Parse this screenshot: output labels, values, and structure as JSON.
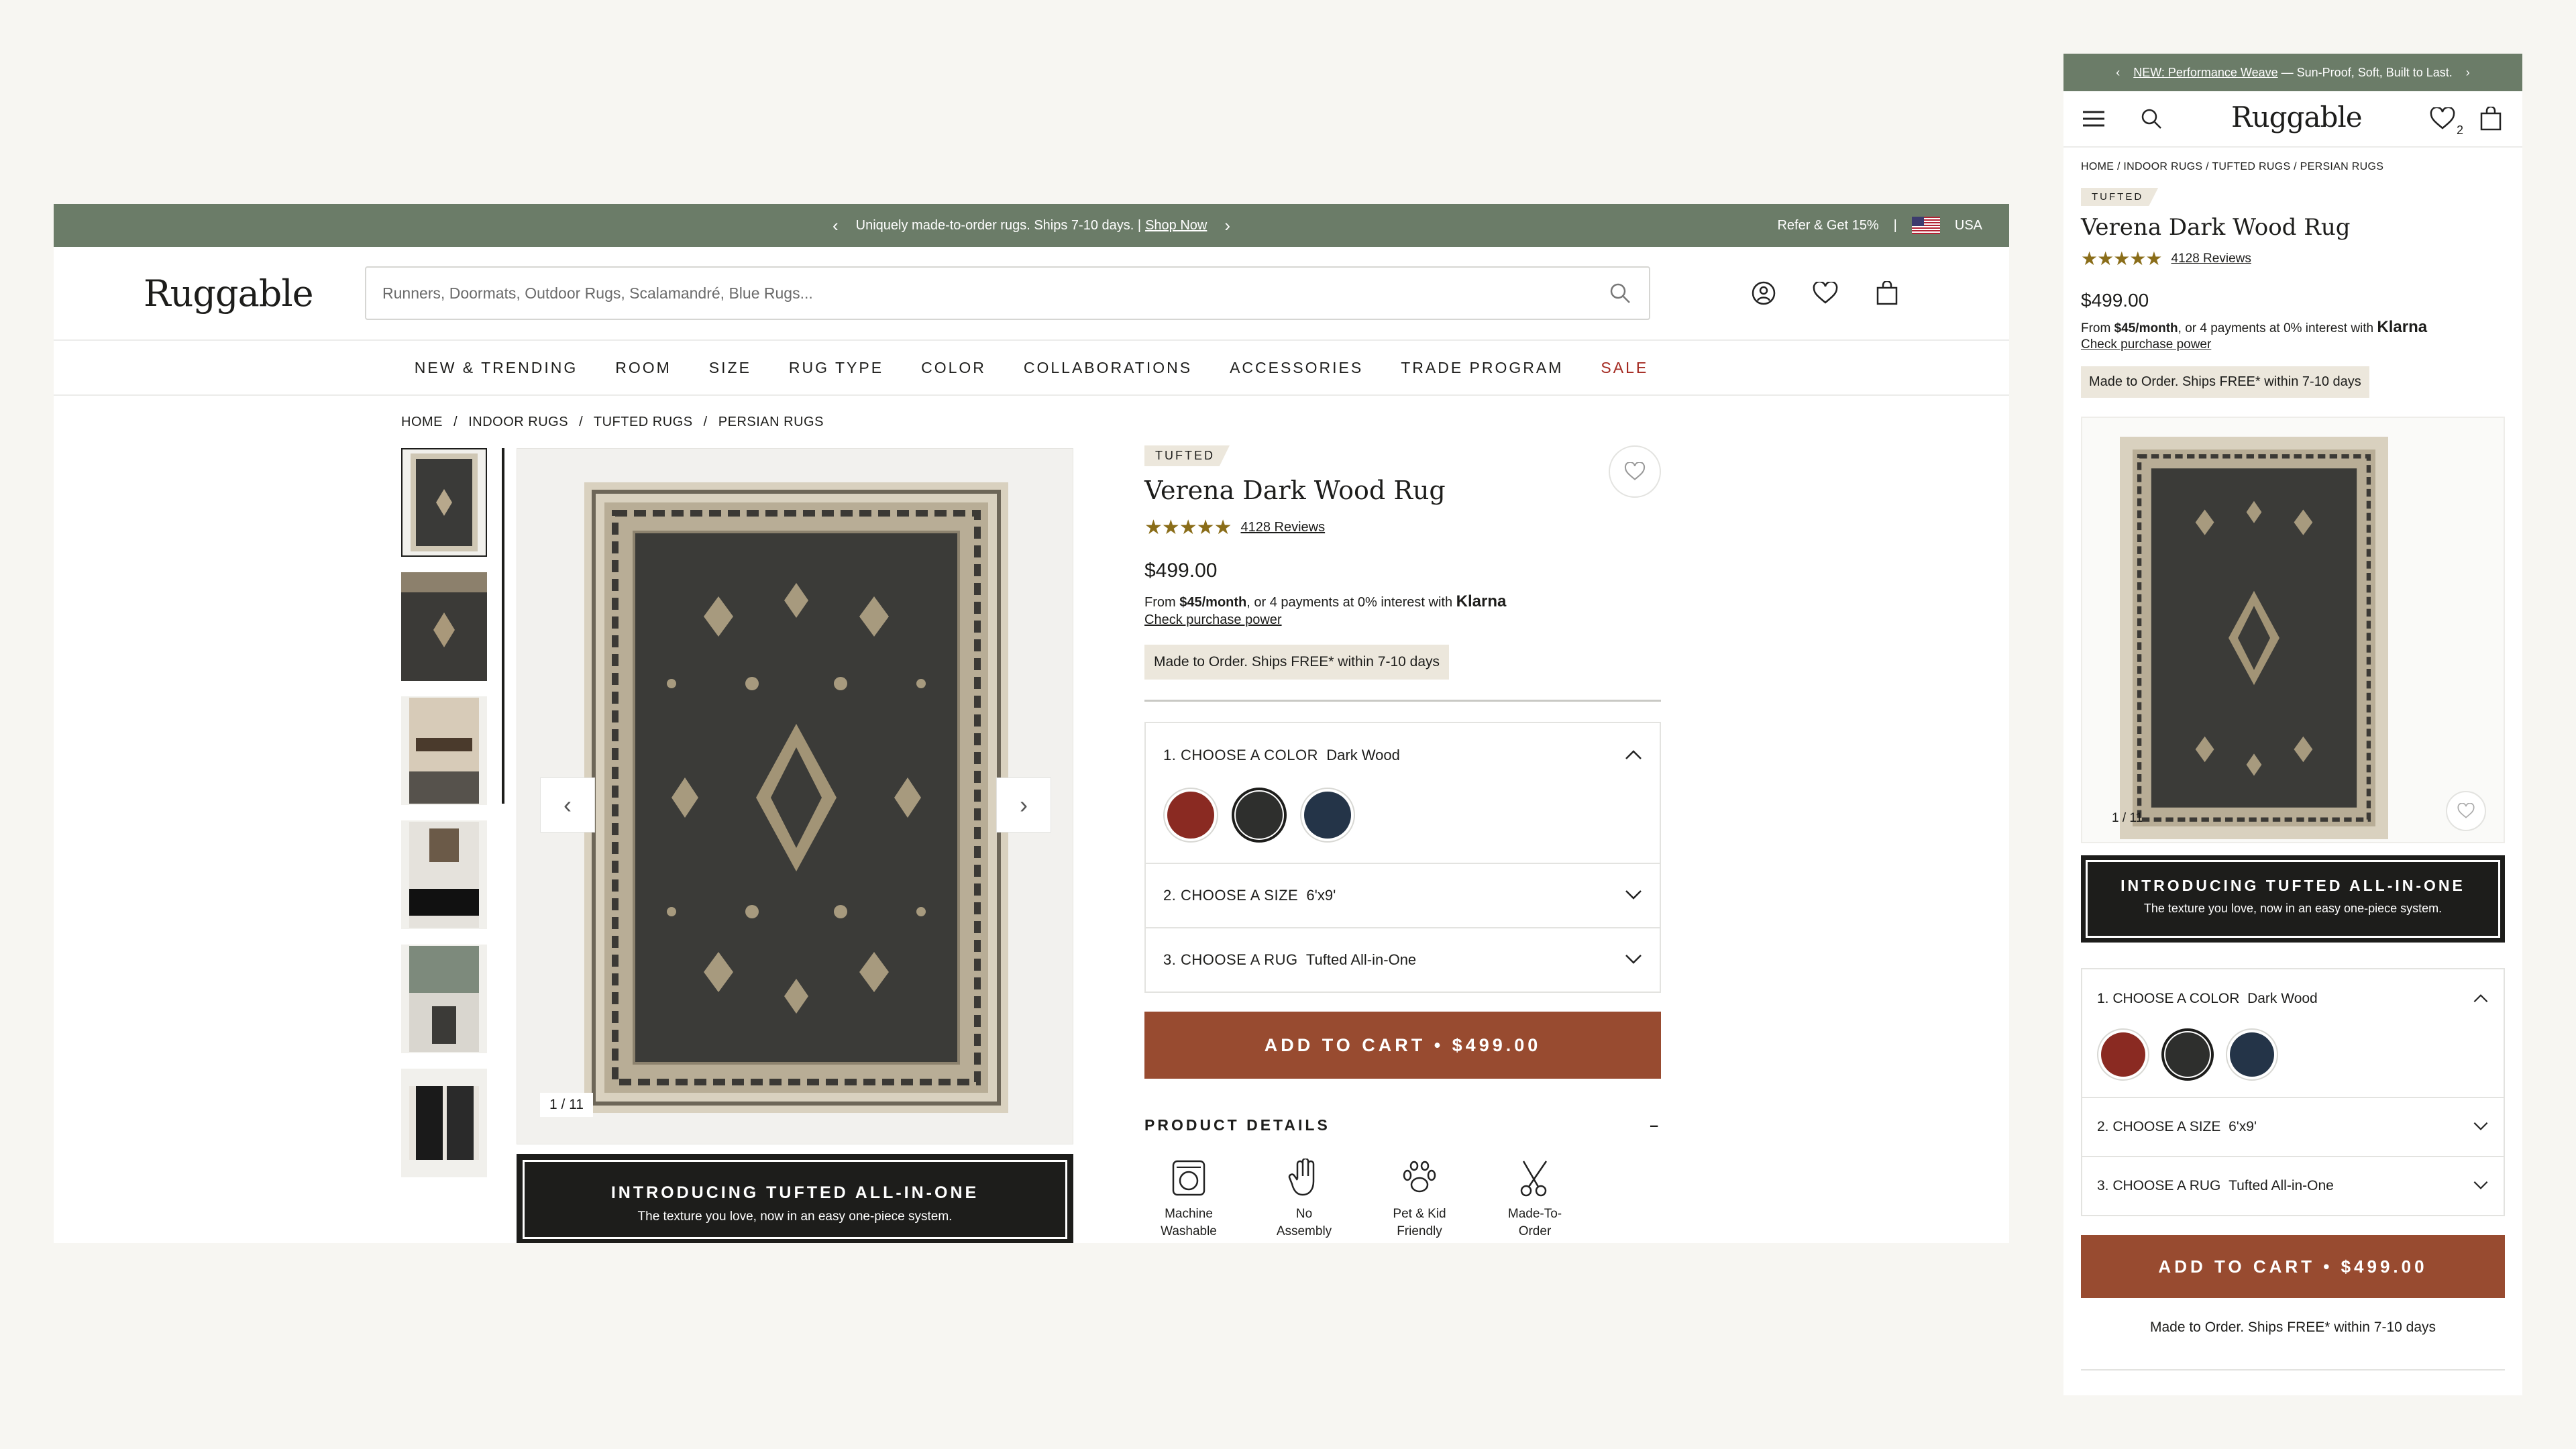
{
  "desktop": {
    "promo": {
      "message": "Uniquely made-to-order rugs. Ships 7-10 days. |",
      "link": "Shop Now",
      "refer": "Refer & Get 15%",
      "separator": "|",
      "country": "USA"
    },
    "logo": "Ruggable",
    "search_placeholder": "Runners, Doormats, Outdoor Rugs, Scalamandré, Blue Rugs...",
    "nav": [
      "NEW & TRENDING",
      "ROOM",
      "SIZE",
      "RUG TYPE",
      "COLOR",
      "COLLABORATIONS",
      "ACCESSORIES",
      "TRADE PROGRAM",
      "SALE"
    ],
    "breadcrumb": [
      "HOME",
      "/",
      "INDOOR RUGS",
      "/",
      "TUFTED RUGS",
      "/",
      "PERSIAN RUGS"
    ],
    "gallery": {
      "counter": "1 / 11"
    },
    "intro": {
      "title": "INTRODUCING TUFTED ALL-IN-ONE",
      "subtitle": "The texture you love, now in an easy one-piece system."
    },
    "product": {
      "badge": "TUFTED",
      "title": "Verena Dark Wood Rug",
      "rating": 5,
      "reviews": "4128 Reviews",
      "price": "$499.00",
      "klarna_from": "From",
      "klarna_amount": "$45/month",
      "klarna_rest": ", or 4 payments at 0% interest with",
      "klarna_brand": "Klarna",
      "klarna_link": "Check purchase power",
      "ship_note": "Made to Order. Ships FREE* within 7-10 days"
    },
    "options": [
      {
        "label": "1. CHOOSE A COLOR",
        "value": "Dark Wood"
      },
      {
        "label": "2. CHOOSE A SIZE",
        "value": "6'x9'"
      },
      {
        "label": "3. CHOOSE A RUG",
        "value": "Tufted All-in-One"
      }
    ],
    "swatch_colors": [
      "#8a2a22",
      "#2e2f2d",
      "#243448"
    ],
    "cart_label": "ADD TO CART • $499.00",
    "details_title": "PRODUCT DETAILS",
    "details_toggle": "–",
    "features": [
      {
        "line1": "Machine",
        "line2": "Washable",
        "icon": "washer-icon"
      },
      {
        "line1": "No",
        "line2": "Assembly",
        "icon": "hand-icon"
      },
      {
        "line1": "Pet & Kid",
        "line2": "Friendly",
        "icon": "paw-icon"
      },
      {
        "line1": "Made-To-",
        "line2": "Order",
        "icon": "scissors-icon"
      }
    ]
  },
  "mobile": {
    "promo_link": "NEW: Performance Weave",
    "promo_rest": "— Sun-Proof, Soft, Built to Last.",
    "logo": "Ruggable",
    "wishlist_count": "2",
    "breadcrumb": "HOME / INDOOR RUGS / TUFTED RUGS / PERSIAN RUGS",
    "badge": "TUFTED",
    "title": "Verena Dark Wood Rug",
    "reviews": "4128 Reviews",
    "price": "$499.00",
    "klarna_from": "From",
    "klarna_amount": "$45/month",
    "klarna_rest": ", or 4 payments at 0% interest with",
    "klarna_brand": "Klarna",
    "klarna_link": "Check purchase power",
    "ship_note": "Made to Order. Ships FREE* within 7-10 days",
    "counter": "1 / 11",
    "intro_title": "INTRODUCING TUFTED ALL-IN-ONE",
    "intro_subtitle": "The texture you love, now in an easy one-piece system.",
    "options": [
      {
        "label": "1. CHOOSE A COLOR",
        "value": "Dark Wood"
      },
      {
        "label": "2. CHOOSE A SIZE",
        "value": "6'x9'"
      },
      {
        "label": "3. CHOOSE A RUG",
        "value": "Tufted All-in-One"
      }
    ],
    "cart_label": "ADD TO CART • $499.00",
    "ship_footer": "Made to Order. Ships FREE* within 7-10 days"
  },
  "colors": {
    "promo": "#6b7c68",
    "cart": "#984b30",
    "star": "#8a6d19",
    "sale": "#a3281f"
  }
}
